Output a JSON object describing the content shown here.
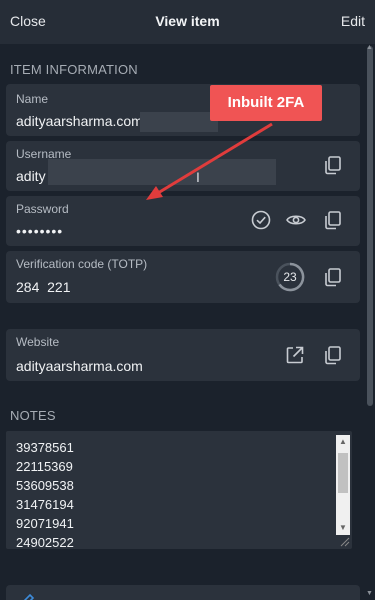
{
  "header": {
    "close": "Close",
    "title": "View item",
    "edit": "Edit"
  },
  "sections": {
    "item_information": "ITEM INFORMATION",
    "notes": "NOTES"
  },
  "annotation": {
    "text": "Inbuilt 2FA",
    "color": "#f05454"
  },
  "fields": {
    "name": {
      "label": "Name",
      "value": "adityaarsharma.com"
    },
    "username": {
      "label": "Username",
      "value": "adity"
    },
    "password": {
      "label": "Password",
      "value": "••••••••"
    },
    "totp": {
      "label": "Verification code (TOTP)",
      "value": "284  221",
      "timer": "23"
    },
    "website": {
      "label": "Website",
      "value": "adityaarsharma.com"
    }
  },
  "notes": {
    "lines": [
      "39378561",
      "22115369",
      "53609538",
      "31476194",
      "92071941",
      "24902522"
    ]
  },
  "icons": {
    "copy": "copy-icon",
    "check": "check-circle-icon",
    "eye": "eye-icon",
    "launch": "launch-icon",
    "edit": "edit-icon"
  },
  "colors": {
    "background": "#1b222c",
    "card": "#2b323c",
    "header": "#262d37",
    "accent_red": "#f05454"
  }
}
